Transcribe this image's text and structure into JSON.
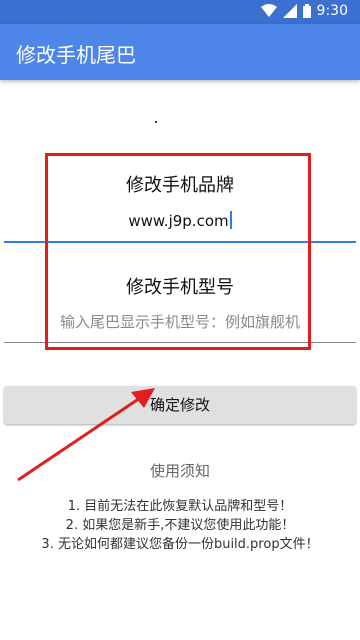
{
  "status_bar": {
    "time": "9:30",
    "icons": [
      "wifi-icon",
      "cellular-signal-icon",
      "battery-icon"
    ]
  },
  "app_bar": {
    "title": "修改手机尾巴"
  },
  "brand_section": {
    "label": "修改手机品牌",
    "input_value": "www.j9p.com"
  },
  "model_section": {
    "label": "修改手机型号",
    "input_placeholder": "输入尾巴显示手机型号：例如旗舰机"
  },
  "confirm_button": {
    "label": "确定修改"
  },
  "notice": {
    "title": "使用须知",
    "items": [
      "1. 目前无法在此恢复默认品牌和型号！",
      "2. 如果您是新手,不建议您使用此功能！",
      "3. 无论如何都建议您备份一份build.prop文件！"
    ]
  },
  "colors": {
    "appbar": "#4d86e8",
    "statusbar": "#3b6fd0",
    "accent": "#2f7ee6",
    "annotation_red": "#e0201e"
  }
}
